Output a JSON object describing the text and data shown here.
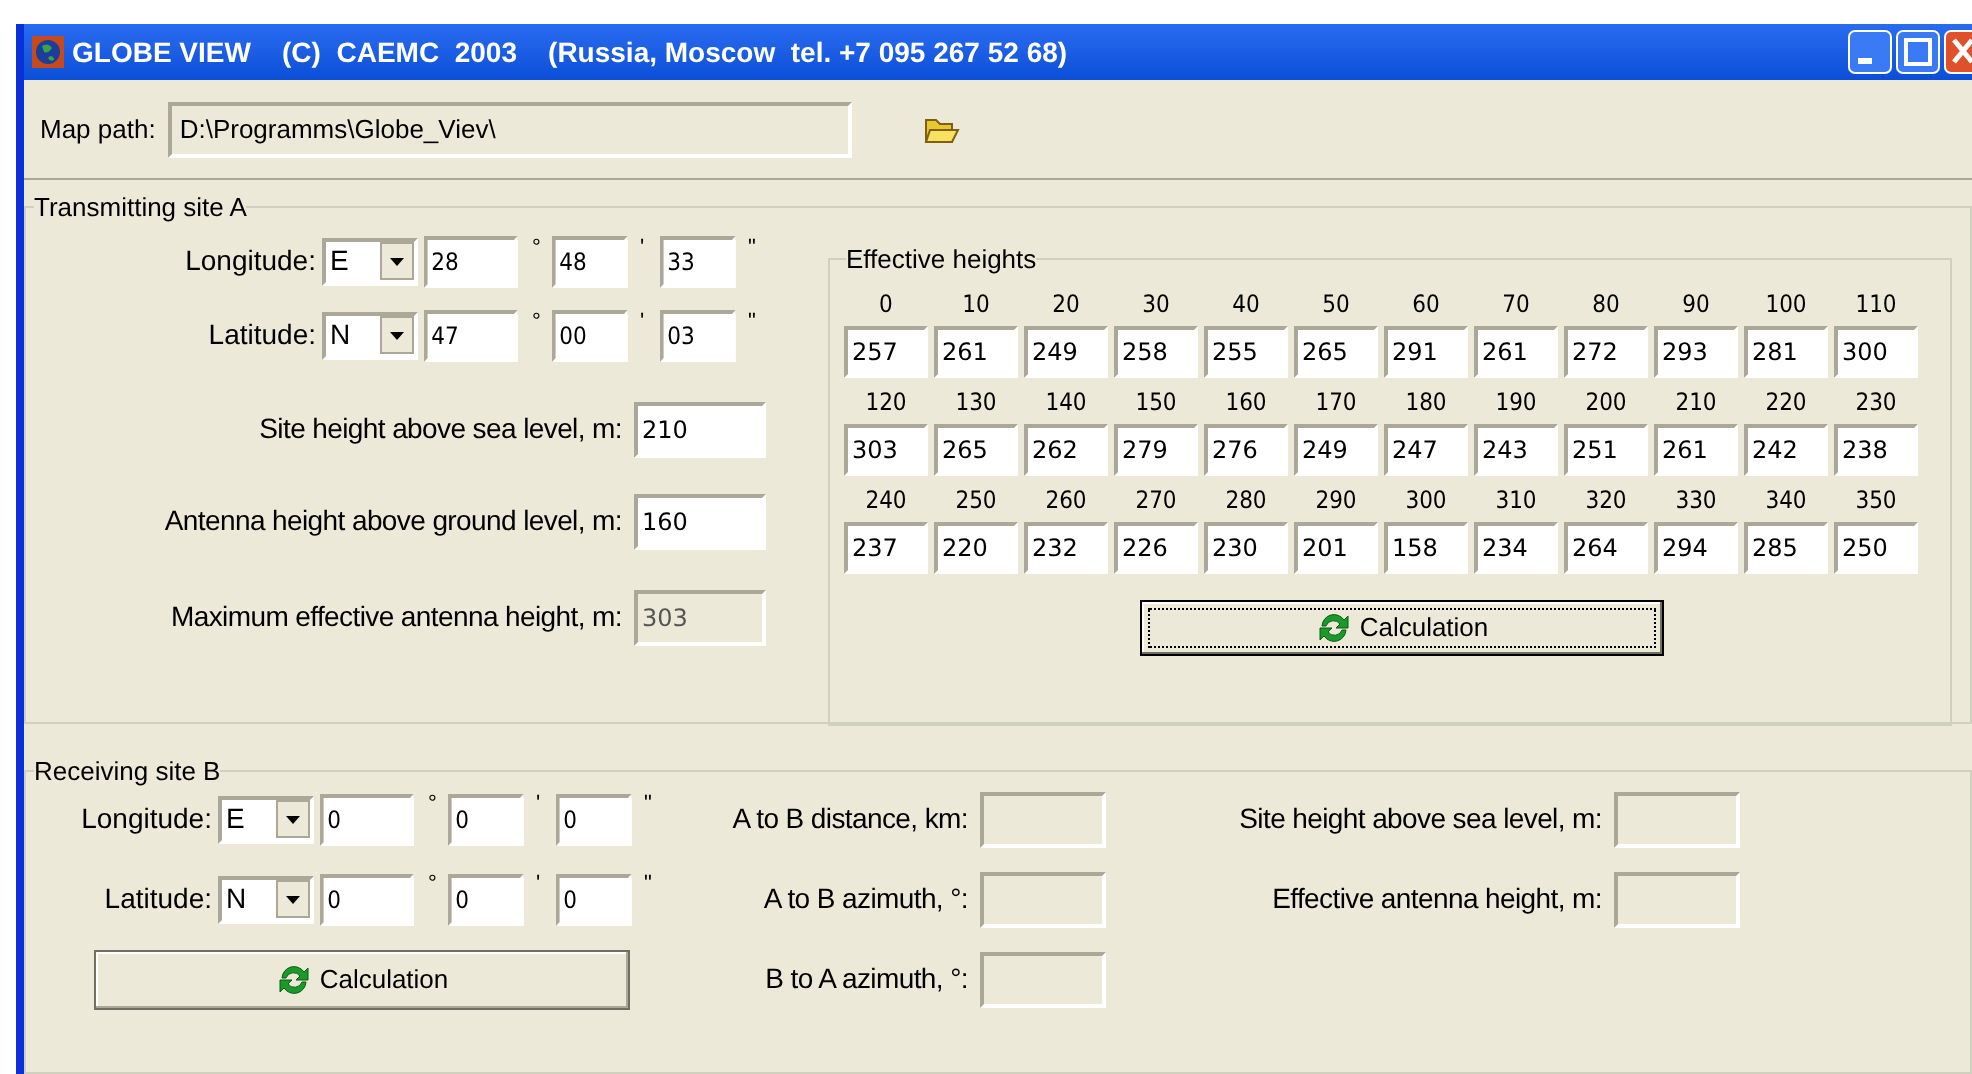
{
  "title_bar": {
    "title": "GLOBE VIEW    (C)  CAEMC  2003    (Russia, Moscow  tel. +7 095 267 52 68)"
  },
  "map_path": {
    "label": "Map path:",
    "value": "D:\\Programms\\Globe_Viev\\"
  },
  "site_a": {
    "title": "Transmitting site A",
    "coordinates": [
      {
        "label": "Longitude:",
        "hemisphere": "E",
        "parts": [
          {
            "value": "28",
            "mark": "°"
          },
          {
            "value": "48",
            "mark": "'"
          },
          {
            "value": "33",
            "mark": "\""
          }
        ]
      },
      {
        "label": "Latitude:",
        "hemisphere": "N",
        "parts": [
          {
            "value": "47",
            "mark": "°"
          },
          {
            "value": "00",
            "mark": "'"
          },
          {
            "value": "03",
            "mark": "\""
          }
        ]
      }
    ],
    "fields": [
      {
        "label": "Site height above sea level, m:",
        "value": "210",
        "disabled": false
      },
      {
        "label": "Antenna height above ground level, m:",
        "value": "160",
        "disabled": false
      },
      {
        "label": "Maximum effective antenna height, m:",
        "value": "303",
        "disabled": true
      }
    ]
  },
  "effective_heights": {
    "title": "Effective heights",
    "rows": [
      {
        "angles": [
          "0",
          "10",
          "20",
          "30",
          "40",
          "50",
          "60",
          "70",
          "80",
          "90",
          "100",
          "110"
        ],
        "values": [
          "257",
          "261",
          "249",
          "258",
          "255",
          "265",
          "291",
          "261",
          "272",
          "293",
          "281",
          "300"
        ]
      },
      {
        "angles": [
          "120",
          "130",
          "140",
          "150",
          "160",
          "170",
          "180",
          "190",
          "200",
          "210",
          "220",
          "230"
        ],
        "values": [
          "303",
          "265",
          "262",
          "279",
          "276",
          "249",
          "247",
          "243",
          "251",
          "261",
          "242",
          "238"
        ]
      },
      {
        "angles": [
          "240",
          "250",
          "260",
          "270",
          "280",
          "290",
          "300",
          "310",
          "320",
          "330",
          "340",
          "350"
        ],
        "values": [
          "237",
          "220",
          "232",
          "226",
          "230",
          "201",
          "158",
          "234",
          "264",
          "294",
          "285",
          "250"
        ]
      }
    ],
    "button": "Calculation"
  },
  "site_b": {
    "title": "Receiving site B",
    "coordinates": [
      {
        "label": "Longitude:",
        "hemisphere": "E",
        "parts": [
          {
            "value": "0",
            "mark": "°"
          },
          {
            "value": "0",
            "mark": "'"
          },
          {
            "value": "0",
            "mark": "\""
          }
        ]
      },
      {
        "label": "Latitude:",
        "hemisphere": "N",
        "parts": [
          {
            "value": "0",
            "mark": "°"
          },
          {
            "value": "0",
            "mark": "'"
          },
          {
            "value": "0",
            "mark": "\""
          }
        ]
      }
    ],
    "button": "Calculation",
    "results": [
      {
        "label": "A to B distance, km:",
        "disabled": true
      },
      {
        "label": "A to B azimuth, °:",
        "disabled": true
      },
      {
        "label": "B to A azimuth, °:",
        "disabled": true
      }
    ],
    "results_right": [
      {
        "label": "Site height above sea level, m:",
        "disabled": true
      },
      {
        "label": "Effective antenna height, m:",
        "disabled": true
      }
    ]
  }
}
